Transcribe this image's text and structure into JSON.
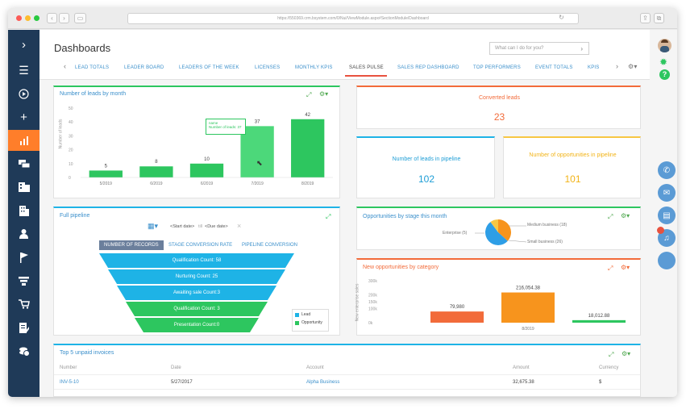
{
  "browser": {
    "url": "https://550369.crm.bsystem.com/0/Nui/ViewModule.aspx#SectionModule/Dashboard"
  },
  "header": {
    "title": "Dashboards",
    "search_placeholder": "What can I do for you?",
    "tabs": [
      {
        "label": "LEAD TOTALS"
      },
      {
        "label": "LEADER BOARD"
      },
      {
        "label": "LEADERS OF THE WEEK"
      },
      {
        "label": "LICENSES"
      },
      {
        "label": "MONTHLY KPIS"
      },
      {
        "label": "SALES PULSE",
        "active": true
      },
      {
        "label": "SALES REP DASHBOARD"
      },
      {
        "label": "TOP PERFORMERS"
      },
      {
        "label": "EVENT TOTALS"
      },
      {
        "label": "KPIS"
      }
    ]
  },
  "leads_by_month": {
    "title": "Number of leads by month",
    "ylabel": "Number of leads",
    "tooltip_name": "name",
    "tooltip_value": "Number of leads: 37",
    "chart_data": {
      "type": "bar",
      "categories": [
        "5/2019",
        "6/2019",
        "6/2019",
        "7/2019",
        "8/2019"
      ],
      "values": [
        5,
        8,
        10,
        37,
        42
      ],
      "ylim": [
        0,
        50
      ],
      "yticks": [
        0,
        10,
        20,
        30,
        40,
        50
      ],
      "ylabel": "Number of leads"
    }
  },
  "converted": {
    "title": "Converted leads",
    "value": "23"
  },
  "in_pipeline": {
    "title": "Number of leads in pipeline",
    "value": "102"
  },
  "opps_pipeline": {
    "title": "Number of opportunities in pipeline",
    "value": "101"
  },
  "full_pipeline": {
    "title": "Full pipeline",
    "start_date": "<Start date>",
    "till": "till",
    "due_date": "<Due date>",
    "tabs": [
      "NUMBER OF RECORDS",
      "STAGE CONVERSION RATE",
      "PIPELINE CONVERSION"
    ],
    "stages": [
      {
        "label": "Qualification Count: 58"
      },
      {
        "label": "Nurturing Count: 25"
      },
      {
        "label": "Awaiting sale Count:3"
      },
      {
        "label": "Qualification Count: 3"
      },
      {
        "label": "Presentation Count:0"
      }
    ],
    "legend": [
      {
        "label": "Lead",
        "color": "#1eb3e6"
      },
      {
        "label": "Opportunity",
        "color": "#2dc65f"
      }
    ]
  },
  "opps_by_stage": {
    "title": "Opportunities by stage this month",
    "chart_data": {
      "type": "pie",
      "slices": [
        {
          "label": "Medium business",
          "value": 18,
          "color": "#f7941d"
        },
        {
          "label": "Small business",
          "value": 26,
          "color": "#2e9ee6"
        },
        {
          "label": "Enterprise",
          "value": 5,
          "color": "#f7c743"
        }
      ]
    },
    "labels": [
      "Medium business (18)",
      "Small business (26)",
      "Enterprise (5)"
    ]
  },
  "new_opps": {
    "title": "New opportunities by category",
    "ylabel": "New enterprise sales",
    "chart_data": {
      "type": "bar",
      "categories": [
        "8/2019"
      ],
      "series": [
        {
          "values": [
            79980
          ],
          "color": "#f26b3a"
        },
        {
          "values": [
            216054.38
          ],
          "color": "#f7941d"
        },
        {
          "values": [
            18012.88
          ],
          "color": "#2dc65f"
        }
      ],
      "value_labels": [
        "79,980",
        "216,054.38",
        "18,012.88"
      ],
      "yticks": [
        "0k",
        "100k",
        "150k",
        "200k",
        "300k"
      ],
      "ylim": [
        0,
        300000
      ]
    }
  },
  "invoices": {
    "title": "Top 5 unpaid invoices",
    "columns": [
      "Number",
      "Date",
      "Account",
      "Amount",
      "Currency"
    ],
    "rows": [
      {
        "number": "INV-5-10",
        "date": "5/27/2017",
        "account": "Alpha Business",
        "amount": "32,675.38",
        "currency": "$"
      }
    ]
  },
  "colors": {
    "sidebar": "#1f3a58",
    "accent": "#ff7e2a",
    "green": "#2dc65f",
    "blue": "#1eb3e6",
    "link": "#3a8fcb"
  }
}
